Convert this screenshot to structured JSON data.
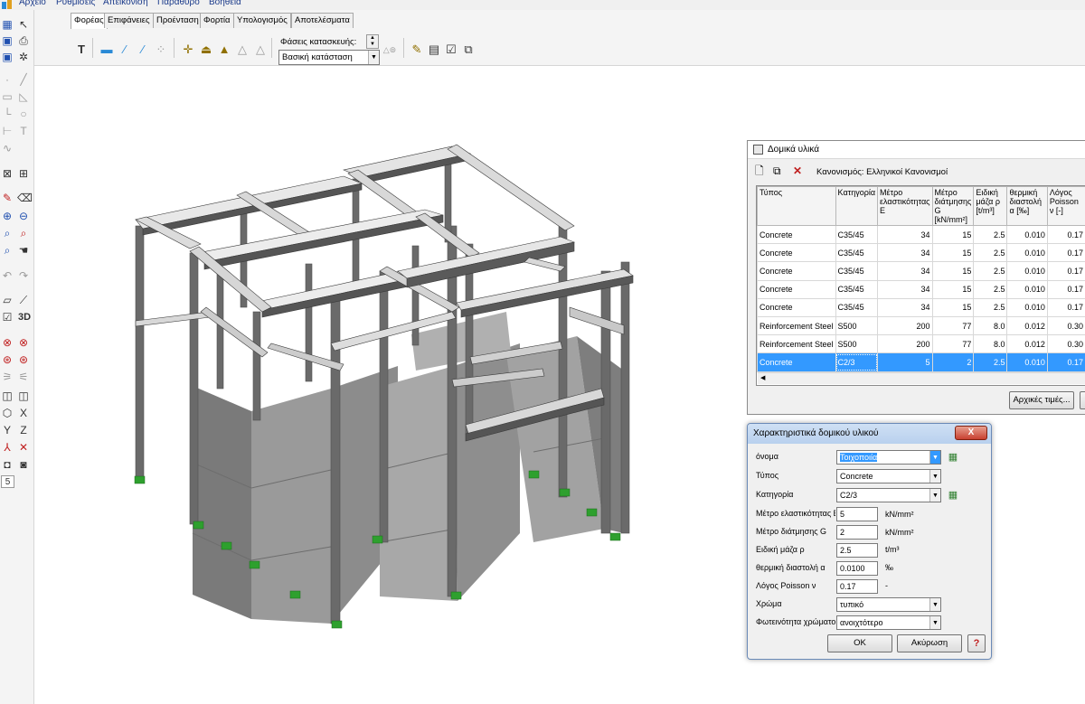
{
  "menu": [
    "Αρχείο",
    "Ρυθμίσεις",
    "Απεικόνιση",
    "Παράθυρο",
    "Βοήθεια"
  ],
  "tabs": [
    "Φορέας",
    "Επιφάνειες",
    "Προένταση",
    "Φορτία",
    "Υπολογισμός",
    "Αποτελέσματα"
  ],
  "active_tab": "Φορέας",
  "phase": {
    "label": "Φάσεις κατασκευής:",
    "value": "Βασική κατάσταση"
  },
  "left_toolbar": {
    "stepper_value": "5",
    "view_3d_label": "3D"
  },
  "materials_window": {
    "title": "Δομικά υλικά",
    "norm_label": "Κανονισμός: Ελληνικοί Κανονισμοί",
    "columns": [
      "Τύπος",
      "Κατηγορία",
      "Μέτρο ελαστικότητας E",
      "Μέτρο διάτμησης G [kN/mm²]",
      "Ειδική μάζα ρ [t/m³]",
      "θερμική διαστολή α [‰]",
      "Λόγος Poisson ν [-]"
    ],
    "rows": [
      {
        "type": "Concrete",
        "category": "C35/45",
        "E": "34",
        "G": "15",
        "rho": "2.5",
        "alpha": "0.010",
        "nu": "0.17"
      },
      {
        "type": "Concrete",
        "category": "C35/45",
        "E": "34",
        "G": "15",
        "rho": "2.5",
        "alpha": "0.010",
        "nu": "0.17"
      },
      {
        "type": "Concrete",
        "category": "C35/45",
        "E": "34",
        "G": "15",
        "rho": "2.5",
        "alpha": "0.010",
        "nu": "0.17"
      },
      {
        "type": "Concrete",
        "category": "C35/45",
        "E": "34",
        "G": "15",
        "rho": "2.5",
        "alpha": "0.010",
        "nu": "0.17"
      },
      {
        "type": "Concrete",
        "category": "C35/45",
        "E": "34",
        "G": "15",
        "rho": "2.5",
        "alpha": "0.010",
        "nu": "0.17"
      },
      {
        "type": "Reinforcement Steel",
        "category": "S500",
        "E": "200",
        "G": "77",
        "rho": "8.0",
        "alpha": "0.012",
        "nu": "0.30"
      },
      {
        "type": "Reinforcement Steel",
        "category": "S500",
        "E": "200",
        "G": "77",
        "rho": "8.0",
        "alpha": "0.012",
        "nu": "0.30"
      },
      {
        "type": "Concrete",
        "category": "C2/3",
        "E": "5",
        "G": "2",
        "rho": "2.5",
        "alpha": "0.010",
        "nu": "0.17"
      }
    ],
    "selected_row": 7,
    "initial_values_button": "Αρχικές τιμές..."
  },
  "props_dialog": {
    "title": "Χαρακτηριστικά δομικού υλικού",
    "close_label": "X",
    "name_label": "όνομα",
    "name_value": "Τοιχοποιία",
    "type_label": "Τύπος",
    "type_value": "Concrete",
    "category_label": "Κατηγορία",
    "category_value": "C2/3",
    "e_label": "Μέτρο ελαστικότητας E",
    "e_value": "5",
    "e_unit": "kN/mm²",
    "g_label": "Μέτρο διάτμησης G",
    "g_value": "2",
    "g_unit": "kN/mm²",
    "rho_label": "Ειδική μάζα ρ",
    "rho_value": "2.5",
    "rho_unit": "t/m³",
    "alpha_label": "θερμική διαστολή α",
    "alpha_value": "0.0100",
    "alpha_unit": "‰",
    "nu_label": "Λόγος Poisson ν",
    "nu_value": "0.17",
    "nu_unit": "-",
    "color_label": "Χρώμα",
    "color_value": "τυπικό",
    "brightness_label": "Φωτεινότητα χρώματος",
    "brightness_value": "ανοιχτότερο",
    "ok_label": "OK",
    "cancel_label": "Ακύρωση",
    "help_label": "?"
  },
  "colors": {
    "selection": "#3399ff",
    "supports": "#2ea02e",
    "structure": "#808080"
  }
}
